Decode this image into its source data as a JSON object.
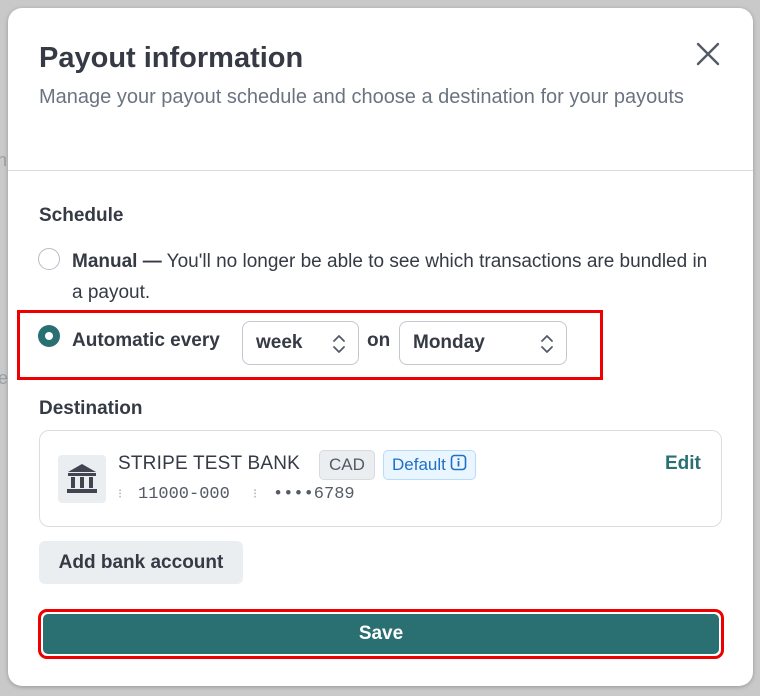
{
  "backdrop": {
    "left_fragment_top": "n",
    "left_fragment_mid": "e"
  },
  "modal": {
    "title": "Payout information",
    "subtitle": "Manage your payout schedule and choose a destination for your payouts"
  },
  "schedule": {
    "label": "Schedule",
    "manual": {
      "title": "Manual —",
      "description": " You'll no longer be able to see which transactions are bundled in a payout.",
      "selected": false
    },
    "automatic": {
      "label": "Automatic every",
      "interval_value": "week",
      "on_label": "on",
      "day_value": "Monday",
      "selected": true
    }
  },
  "destination": {
    "label": "Destination",
    "bank_name": "STRIPE TEST BANK",
    "currency_badge": "CAD",
    "default_badge": "Default",
    "routing_number": "11000-000",
    "account_number": "••••6789",
    "edit_label": "Edit",
    "icon": "bank-icon"
  },
  "actions": {
    "add_bank_label": "Add bank account",
    "save_label": "Save"
  },
  "colors": {
    "accent": "#2a6f72",
    "highlight": "#e00000",
    "default_badge_text": "#1f6fc5"
  }
}
